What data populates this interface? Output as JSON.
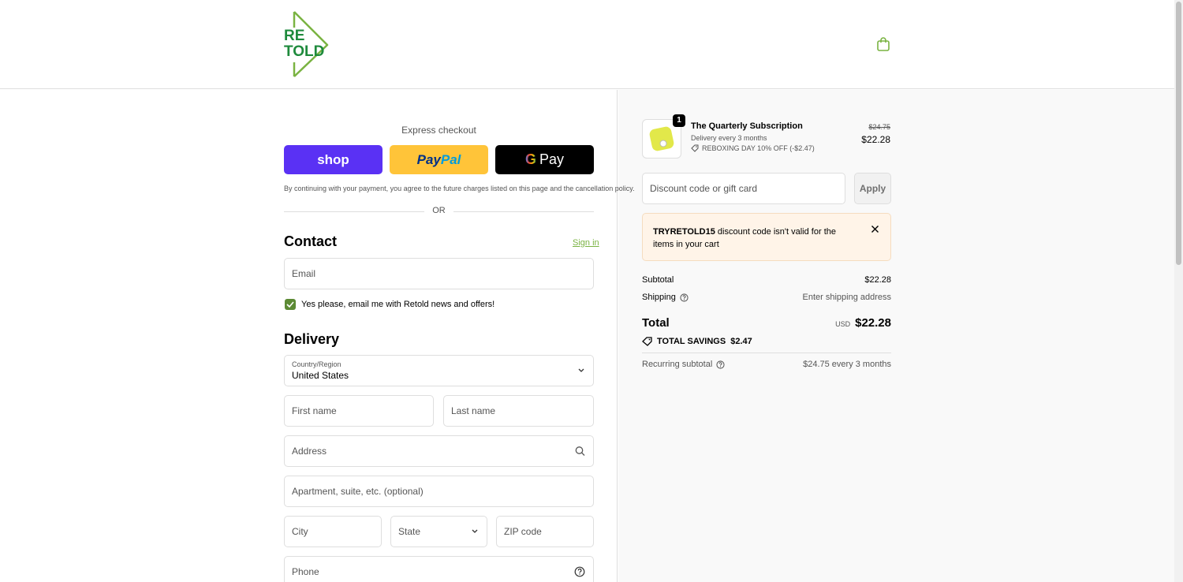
{
  "brand": {
    "logo_line1": "RE",
    "logo_line2": "TOLD",
    "color": "#7ab342"
  },
  "checkout": {
    "express_label": "Express checkout",
    "shop_label": "shop",
    "paypal_label_1": "Pay",
    "paypal_label_2": "Pal",
    "gpay_g": "G",
    "gpay_label": "Pay",
    "consent": "By continuing with your payment, you agree to the future charges listed on this page and the cancellation policy.",
    "or_label": "OR"
  },
  "contact": {
    "title": "Contact",
    "signin": "Sign in",
    "email_placeholder": "Email",
    "newsletter_label": "Yes please, email me with Retold news and offers!",
    "newsletter_checked": true
  },
  "delivery": {
    "title": "Delivery",
    "country_label": "Country/Region",
    "country_value": "United States",
    "first_name": "First name",
    "last_name": "Last name",
    "address": "Address",
    "apartment": "Apartment, suite, etc. (optional)",
    "city": "City",
    "state": "State",
    "zip": "ZIP code",
    "phone": "Phone"
  },
  "order": {
    "quantity": "1",
    "product_title": "The Quarterly Subscription",
    "product_sub": "Delivery every 3 months",
    "product_discount": "REBOXING DAY 10% OFF (-$2.47)",
    "old_price": "$24.75",
    "new_price": "$22.28",
    "discount_placeholder": "Discount code or gift card",
    "apply_label": "Apply",
    "alert_code": "TRYRETOLD15",
    "alert_text": " discount code isn't valid for the items in your cart",
    "subtotal_label": "Subtotal",
    "subtotal_value": "$22.28",
    "shipping_label": "Shipping",
    "shipping_value": "Enter shipping address",
    "total_label": "Total",
    "currency": "USD",
    "total_value": "$22.28",
    "savings_label": "TOTAL SAVINGS",
    "savings_value": "$2.47",
    "recurring_label": "Recurring subtotal",
    "recurring_value": "$24.75 every 3 months"
  }
}
